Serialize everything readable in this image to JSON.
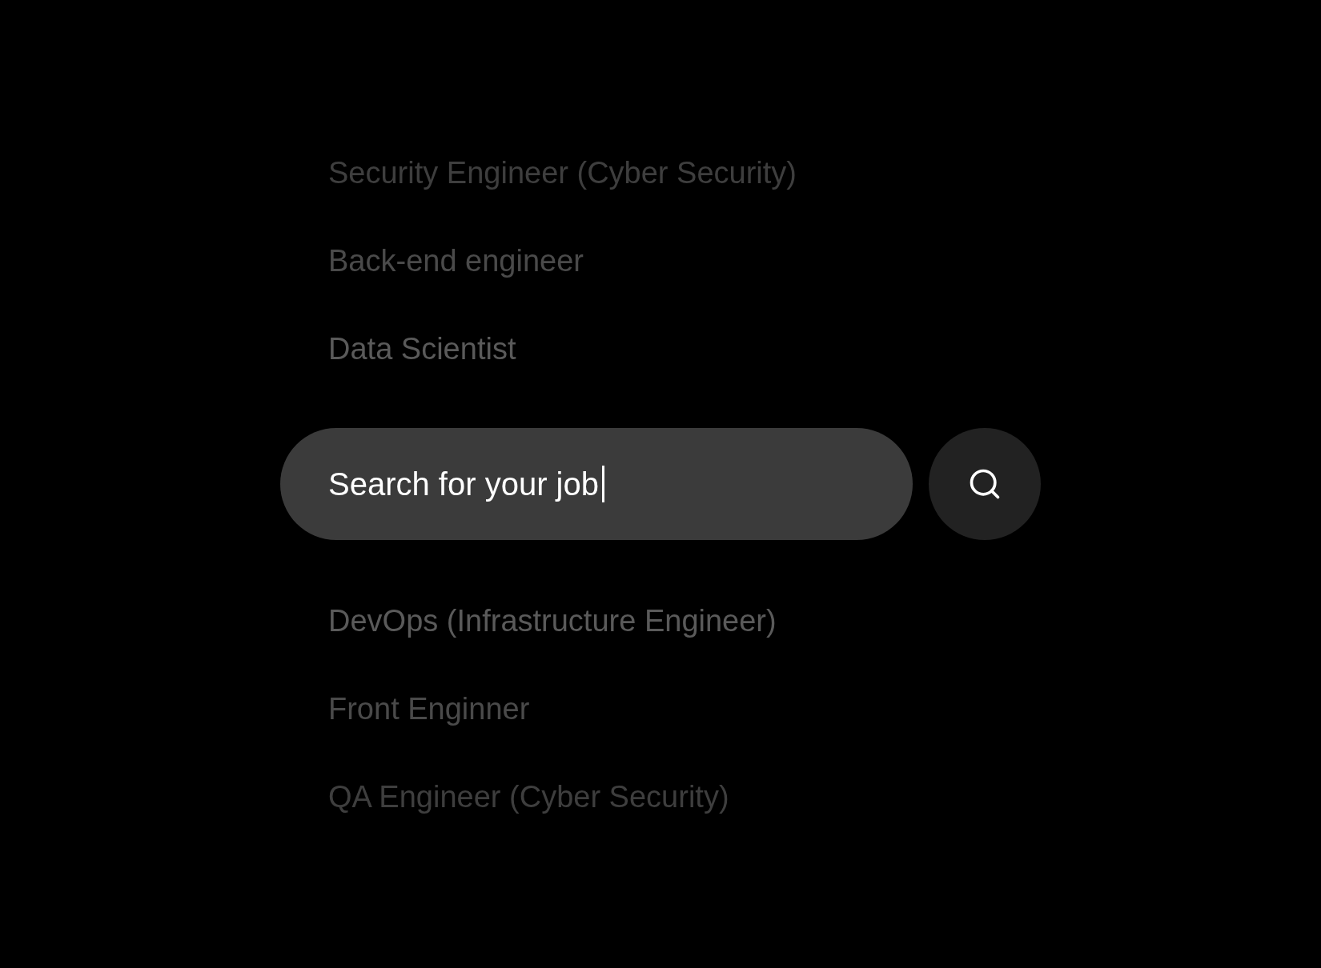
{
  "suggestions_above": [
    {
      "label": "Security Engineer (Cyber Security)",
      "kind": "far"
    },
    {
      "label": "Back-end engineer",
      "kind": "mid"
    },
    {
      "label": "Data Scientist",
      "kind": "near"
    }
  ],
  "search": {
    "value": "Search for your job",
    "focused": true
  },
  "suggestions_below": [
    {
      "label": "DevOps (Infrastructure Engineer)",
      "kind": "near"
    },
    {
      "label": "Front Enginner",
      "kind": "mid"
    },
    {
      "label": "QA Engineer (Cyber Security)",
      "kind": "far"
    }
  ]
}
